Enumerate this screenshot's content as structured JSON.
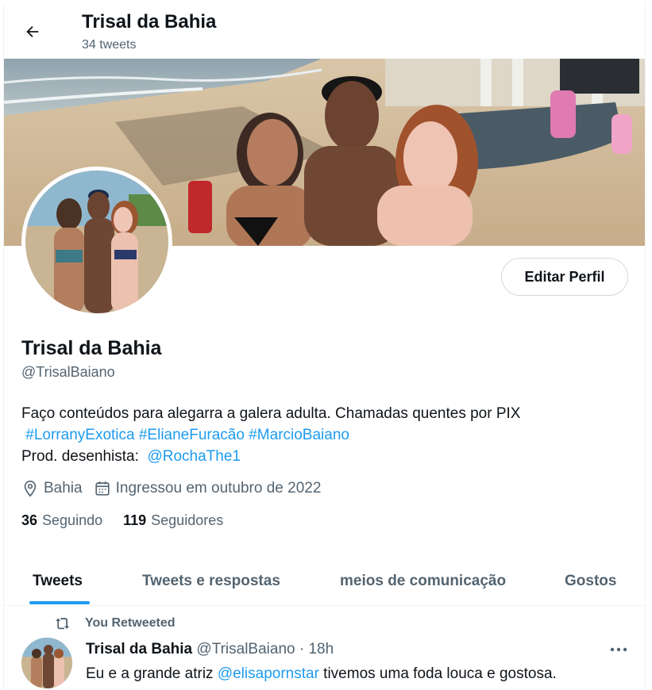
{
  "header": {
    "title": "Trisal da Bahia",
    "tweet_count": "34 tweets"
  },
  "profile": {
    "name": "Trisal da Bahia",
    "handle": "@TrisalBaiano",
    "edit_label": "Editar Perfil",
    "bio_line1": "Faço conteúdos para alegarra a galera adulta. Chamadas quentes por PIX",
    "hashtags": [
      "#LorranyExotica",
      "#ElianeFuracão",
      "#MarcioBaiano"
    ],
    "bio_line3_prefix": "Prod. desenhista:",
    "bio_mention": "@RochaThe1",
    "location": "Bahia",
    "joined": "Ingressou em outubro de 2022",
    "following_count": "36",
    "following_label": "Seguindo",
    "followers_count": "119",
    "followers_label": "Seguidores"
  },
  "tabs": [
    {
      "label": "Tweets"
    },
    {
      "label": "Tweets e respostas"
    },
    {
      "label": "meios de comunicação"
    },
    {
      "label": "Gostos"
    }
  ],
  "tweet": {
    "retweet_label": "You Retweeted",
    "author": "Trisal da Bahia",
    "handle": "@TrisalBaiano",
    "dot": "·",
    "time": "18h",
    "text_before": "Eu e a grande atriz ",
    "mention": "@elisapornstar",
    "text_after": " tivemos uma foda louca e gostosa."
  },
  "colors": {
    "accent": "#1d9bf0",
    "text": "#0f1419",
    "muted": "#536471",
    "border": "#cfd9de"
  },
  "icons": [
    "back-arrow-icon",
    "location-pin-icon",
    "calendar-icon",
    "retweet-icon",
    "more-dots-icon"
  ]
}
